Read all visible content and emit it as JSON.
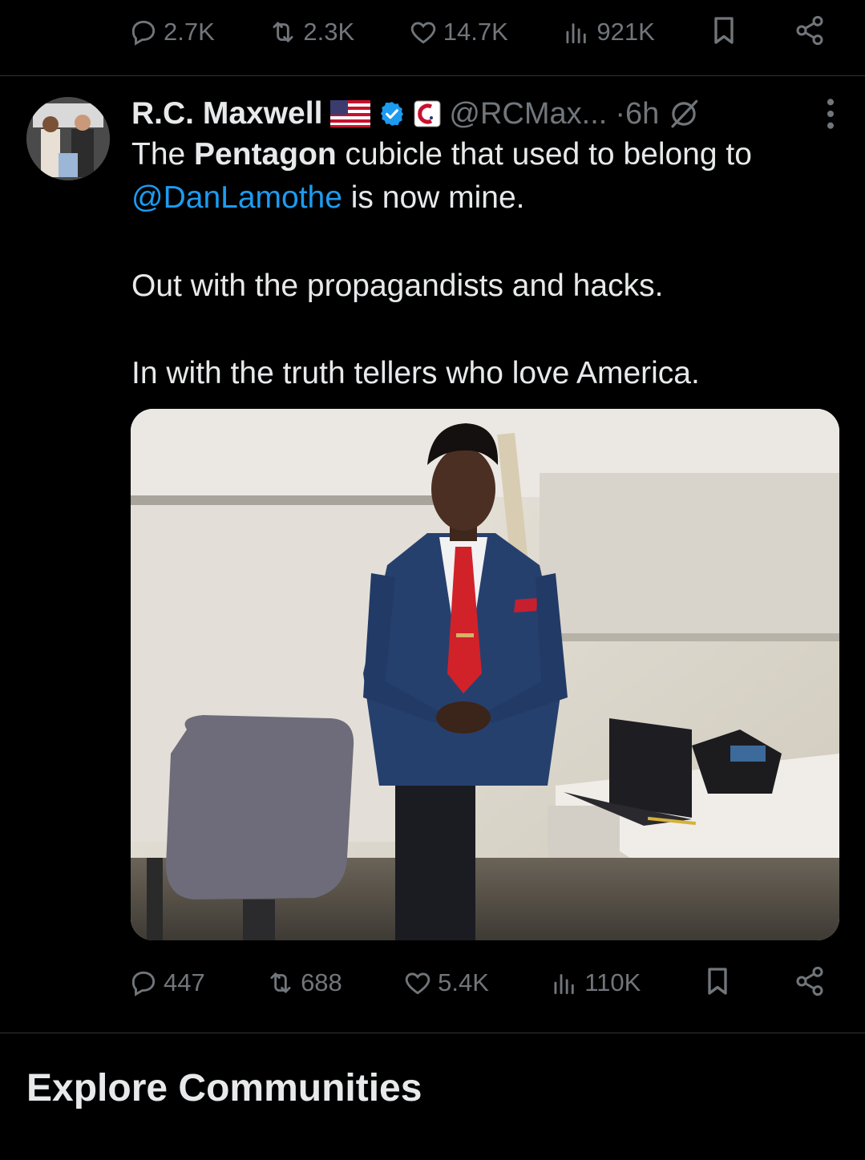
{
  "prev_actions": {
    "replies": "2.7K",
    "reposts": "2.3K",
    "likes": "14.7K",
    "views": "921K"
  },
  "tweet": {
    "author_name": "R.C. Maxwell",
    "handle": "@RCMax...",
    "time": "·6h",
    "text": {
      "l1_prefix": "The ",
      "l1_bold": "Pentagon",
      "l1_suffix": " cubicle that used to belong to",
      "mention": "@DanLamothe",
      "l2_suffix": " is now mine.",
      "p2": "Out with the propagandists and hacks.",
      "p3": "In with the truth tellers who love America."
    },
    "actions": {
      "replies": "447",
      "reposts": "688",
      "likes": "5.4K",
      "views": "110K"
    }
  },
  "section": {
    "title": "Explore Communities"
  },
  "colors": {
    "background": "#000000",
    "text": "#e7e9ea",
    "muted": "#71767b",
    "accent": "#1d9bf0",
    "divider": "#2f3336"
  },
  "icons": [
    "reply-icon",
    "repost-icon",
    "like-icon",
    "views-icon",
    "bookmark-icon",
    "share-icon",
    "flag-us-icon",
    "verified-badge-icon",
    "affiliate-logo-icon",
    "grok-icon",
    "more-icon"
  ]
}
